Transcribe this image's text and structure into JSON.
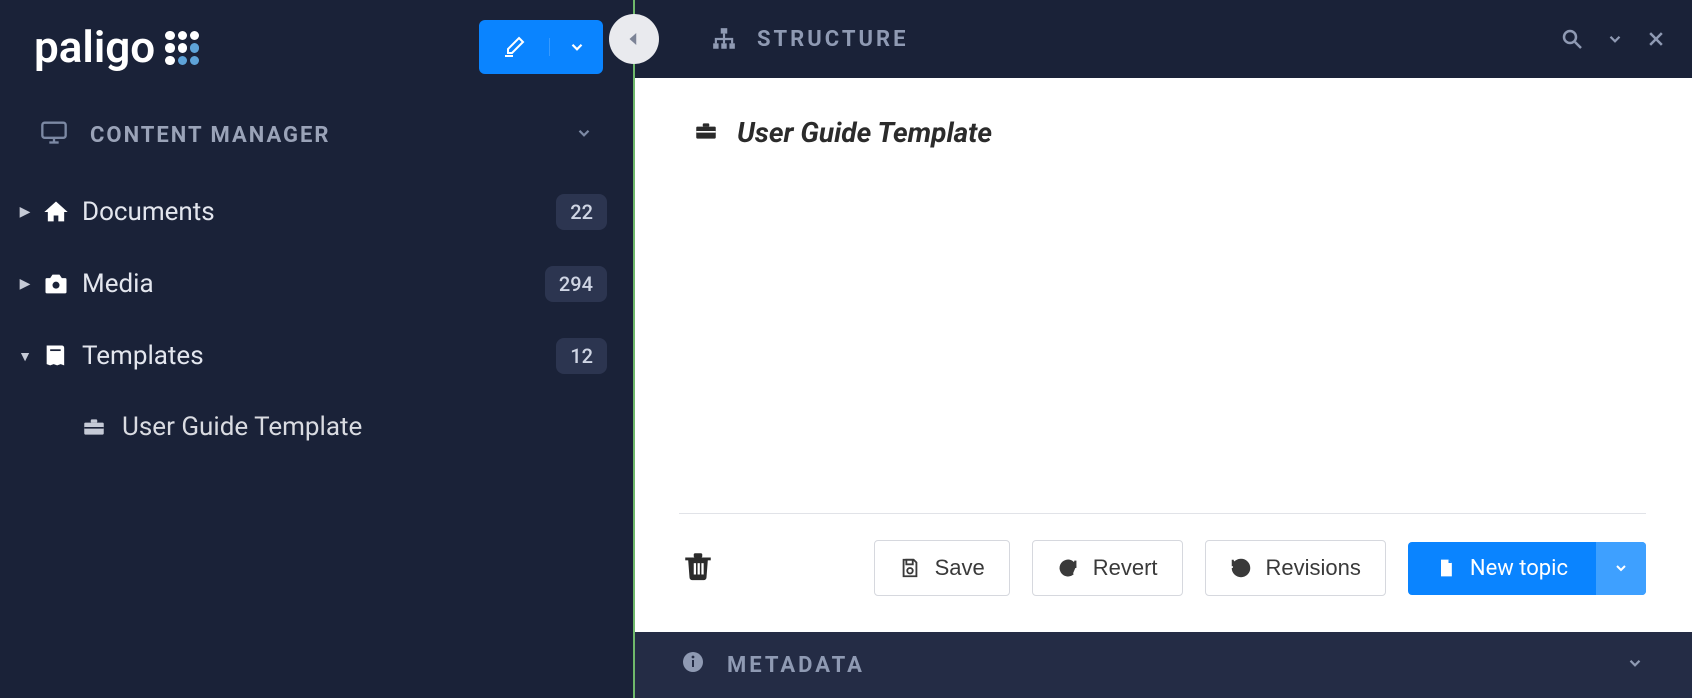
{
  "brand": {
    "name": "paligo"
  },
  "sidebar": {
    "section_label": "CONTENT MANAGER",
    "items": [
      {
        "label": "Documents",
        "count": "22",
        "icon": "home",
        "expanded": false
      },
      {
        "label": "Media",
        "count": "294",
        "icon": "camera",
        "expanded": false
      },
      {
        "label": "Templates",
        "count": "12",
        "icon": "book",
        "expanded": true,
        "children": [
          {
            "label": "User Guide Template",
            "icon": "briefcase"
          }
        ]
      }
    ]
  },
  "structure": {
    "title": "STRUCTURE",
    "document_title": "User Guide Template"
  },
  "toolbar": {
    "save_label": "Save",
    "revert_label": "Revert",
    "revisions_label": "Revisions",
    "new_topic_label": "New topic"
  },
  "metadata": {
    "title": "METADATA"
  },
  "colors": {
    "accent_blue": "#0a84ff",
    "sidebar_bg": "#1a2238"
  }
}
